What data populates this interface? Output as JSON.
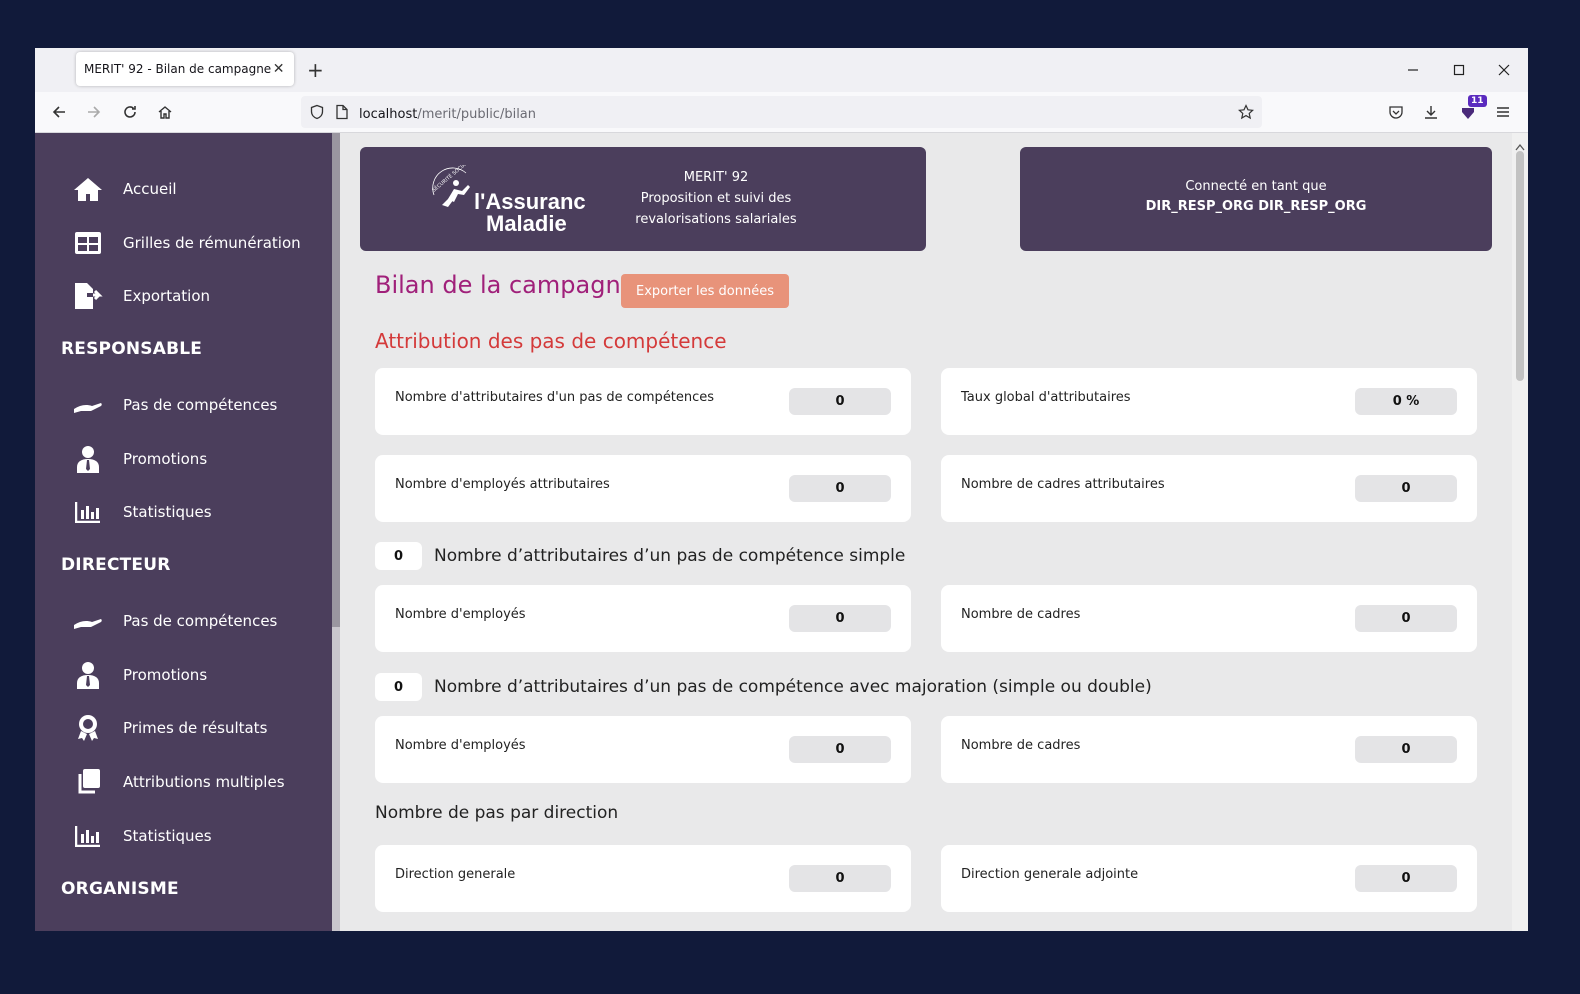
{
  "browser": {
    "tab_title": "MERIT' 92 - Bilan de campagne",
    "url_host": "localhost",
    "url_path": "/merit/public/bilan",
    "notification_count": "11"
  },
  "sidebar": {
    "items": [
      {
        "label": "Accueil",
        "icon": "home-icon"
      },
      {
        "label": "Grilles de rémunération",
        "icon": "table-icon"
      },
      {
        "label": "Exportation",
        "icon": "file-export-icon"
      }
    ],
    "sections": [
      {
        "title": "RESPONSABLE",
        "items": [
          {
            "label": "Pas de compétences",
            "icon": "hand-icon"
          },
          {
            "label": "Promotions",
            "icon": "user-tie-icon"
          },
          {
            "label": "Statistiques",
            "icon": "chart-icon"
          }
        ]
      },
      {
        "title": "DIRECTEUR",
        "items": [
          {
            "label": "Pas de compétences",
            "icon": "hand-icon"
          },
          {
            "label": "Promotions",
            "icon": "user-tie-icon"
          },
          {
            "label": "Primes de résultats",
            "icon": "award-icon"
          },
          {
            "label": "Attributions multiples",
            "icon": "copy-icon"
          },
          {
            "label": "Statistiques",
            "icon": "chart-icon"
          }
        ]
      },
      {
        "title": "ORGANISME",
        "items": []
      }
    ]
  },
  "header": {
    "logo_line1": "l'Assurance",
    "logo_line2": "Maladie",
    "logo_small": "SÉCURITÉ SOCIALE",
    "app_name": "MERIT' 92",
    "app_desc_line1": "Proposition et suivi des",
    "app_desc_line2": "revalorisations salariales",
    "user_prefix": "Connecté en tant que",
    "user_name": "DIR_RESP_ORG DIR_RESP_ORG"
  },
  "page": {
    "title": "Bilan de la campagne",
    "export_label": "Exporter les données",
    "section_title": "Attribution des pas de compétence",
    "stats_top": [
      {
        "label": "Nombre d'attributaires d'un pas de compétences",
        "value": "0"
      },
      {
        "label": "Taux global d'attributaires",
        "value": "0 %"
      },
      {
        "label": "Nombre d'employés attributaires",
        "value": "0"
      },
      {
        "label": "Nombre de cadres attributaires",
        "value": "0"
      }
    ],
    "simple": {
      "count": "0",
      "label": "Nombre d’attributaires d’un pas de compétence simple",
      "stats": [
        {
          "label": "Nombre d'employés",
          "value": "0"
        },
        {
          "label": "Nombre de cadres",
          "value": "0"
        }
      ]
    },
    "majoration": {
      "count": "0",
      "label": "Nombre d’attributaires d’un pas de compétence avec majoration (simple ou double)",
      "stats": [
        {
          "label": "Nombre d'employés",
          "value": "0"
        },
        {
          "label": "Nombre de cadres",
          "value": "0"
        }
      ]
    },
    "direction_title": "Nombre de pas par direction",
    "directions": [
      {
        "label": "Direction generale",
        "value": "0"
      },
      {
        "label": "Direction generale adjointe",
        "value": "0"
      }
    ]
  },
  "colors": {
    "sidebar_bg": "#4b3e5c",
    "title_color": "#a0207a",
    "section_color": "#d43a3a",
    "export_btn": "#e8937a"
  }
}
